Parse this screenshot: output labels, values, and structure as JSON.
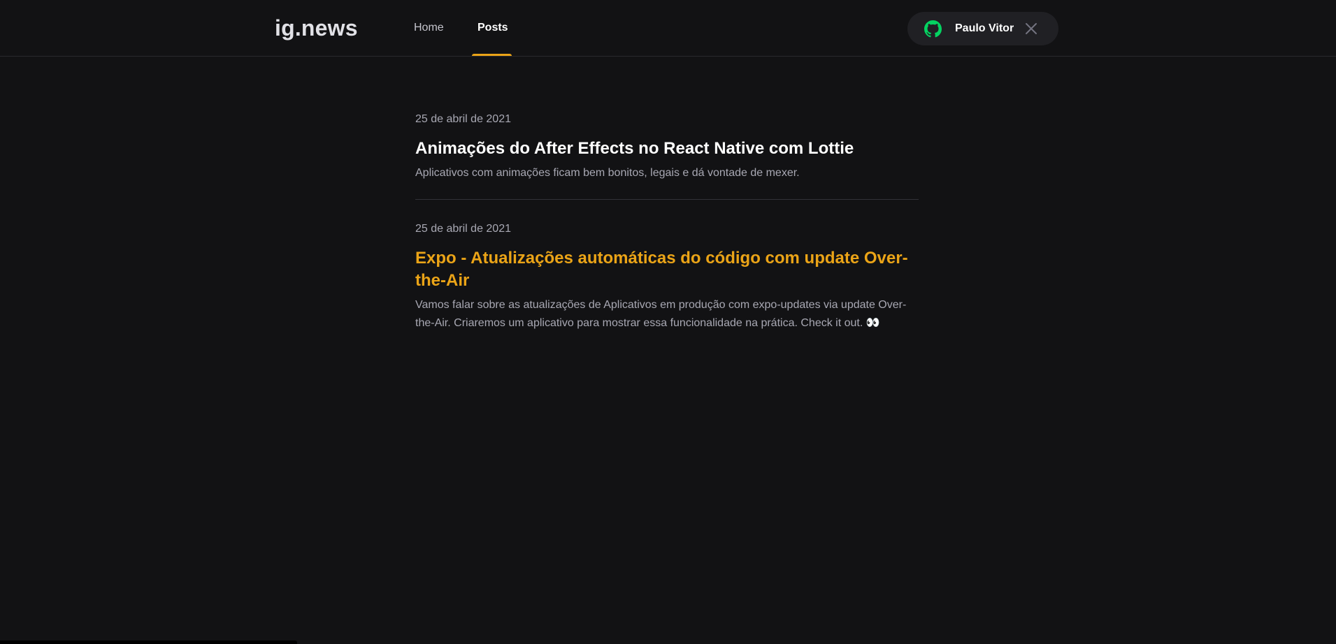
{
  "header": {
    "logo": "ig.news",
    "nav": [
      {
        "label": "Home",
        "active": false
      },
      {
        "label": "Posts",
        "active": true
      }
    ],
    "user": {
      "name": "Paulo Vitor",
      "icon": "github-icon",
      "close_icon": "close-icon"
    }
  },
  "posts": [
    {
      "date": "25 de abril de 2021",
      "title": "Animações do After Effects no React Native com Lottie",
      "excerpt": "Aplicativos com animações ficam bem bonitos, legais e dá vontade de mexer."
    },
    {
      "date": "25 de abril de 2021",
      "title": "Expo - Atualizações automáticas do código com update Over-the-Air",
      "excerpt": "Vamos falar sobre as atualizações de Aplicativos em produção com expo-updates via update Over-the-Air. Criaremos um aplicativo para mostrar essa funcionalidade na prática. Check it out. 👀"
    }
  ],
  "colors": {
    "background": "#121214",
    "accent": "#eba417",
    "github_green": "#04d361"
  }
}
